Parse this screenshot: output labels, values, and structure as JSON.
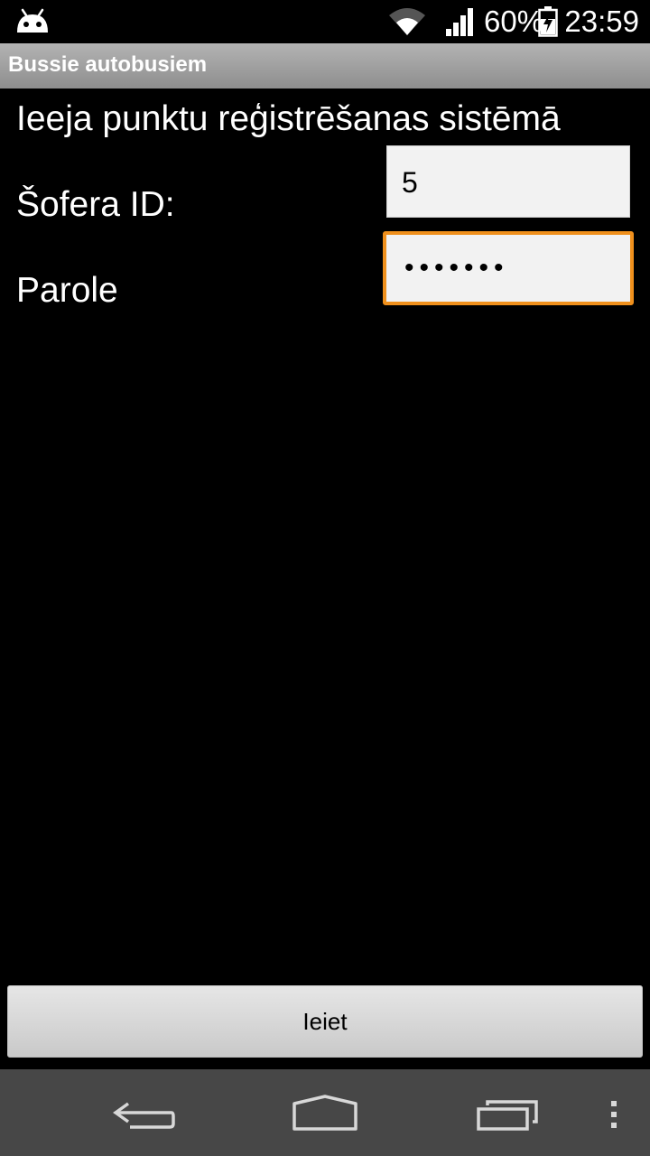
{
  "status_bar": {
    "battery_percent": "60%",
    "time": "23:59",
    "icons": [
      "android-icon",
      "wifi-icon",
      "signal-icon",
      "battery-charging-icon"
    ]
  },
  "app": {
    "title": "Bussie autobusiem"
  },
  "form": {
    "heading": "Ieeja punktu reģistrēšanas sistēmā",
    "driver_id_label": "Šofera ID:",
    "driver_id_value": "5",
    "password_label": "Parole",
    "password_mask": "•••••••"
  },
  "actions": {
    "login_label": "Ieiet"
  },
  "nav_bar": {
    "icons": [
      "back-icon",
      "home-icon",
      "recents-icon",
      "menu-icon"
    ]
  },
  "colors": {
    "focus_accent": "#f0901c",
    "title_bar": "#a0a0a0",
    "nav_bar": "#474747"
  }
}
